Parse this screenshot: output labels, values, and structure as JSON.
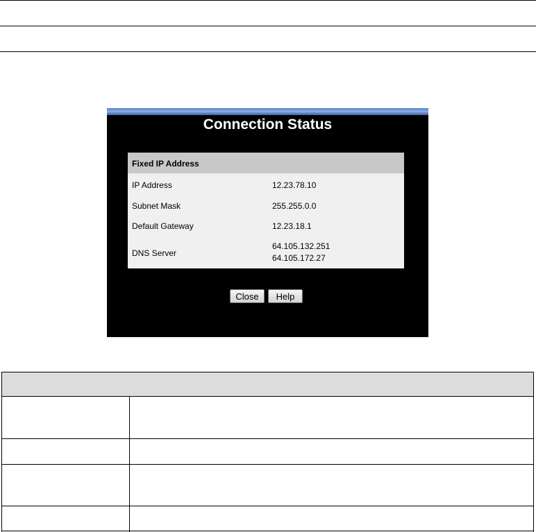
{
  "dialog": {
    "title": "Connection Status",
    "section_header": "Fixed IP Address",
    "rows": [
      {
        "label": "IP Address",
        "value": "12.23.78.10"
      },
      {
        "label": "Subnet Mask",
        "value": "255.255.0.0"
      },
      {
        "label": "Default Gateway",
        "value": "12.23.18.1"
      },
      {
        "label": "DNS Server",
        "value": "64.105.132.251",
        "value2": "64.105.172.27"
      }
    ],
    "buttons": {
      "close": "Close",
      "help": "Help"
    }
  }
}
